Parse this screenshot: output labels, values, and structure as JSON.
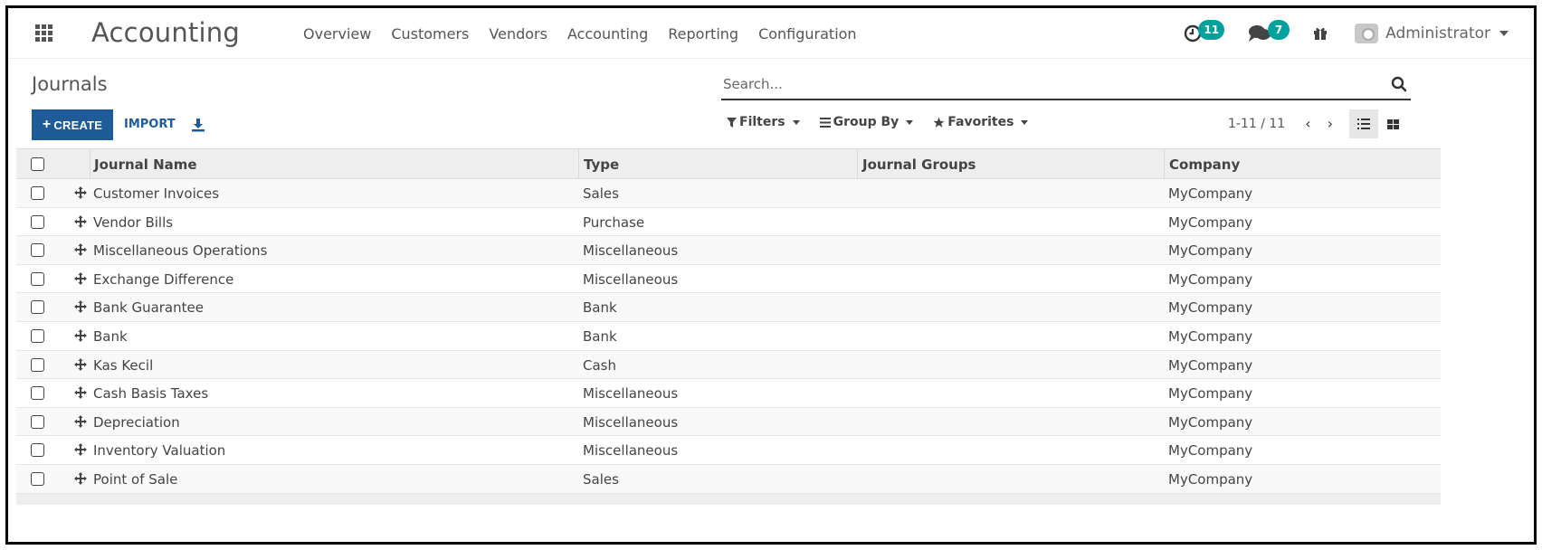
{
  "app": {
    "title": "Accounting"
  },
  "menu": [
    "Overview",
    "Customers",
    "Vendors",
    "Accounting",
    "Reporting",
    "Configuration"
  ],
  "systray": {
    "activity_count": "11",
    "messages_count": "7",
    "user": "Administrator"
  },
  "breadcrumb": "Journals",
  "search": {
    "placeholder": "Search..."
  },
  "actions": {
    "create": "CREATE",
    "import": "IMPORT"
  },
  "filters": {
    "filters": "Filters",
    "group_by": "Group By",
    "favorites": "Favorites"
  },
  "pager": {
    "range": "1-11 / 11"
  },
  "columns": [
    "Journal Name",
    "Type",
    "Journal Groups",
    "Company"
  ],
  "rows": [
    {
      "name": "Customer Invoices",
      "type": "Sales",
      "groups": "",
      "company": "MyCompany"
    },
    {
      "name": "Vendor Bills",
      "type": "Purchase",
      "groups": "",
      "company": "MyCompany"
    },
    {
      "name": "Miscellaneous Operations",
      "type": "Miscellaneous",
      "groups": "",
      "company": "MyCompany"
    },
    {
      "name": "Exchange Difference",
      "type": "Miscellaneous",
      "groups": "",
      "company": "MyCompany"
    },
    {
      "name": "Bank Guarantee",
      "type": "Bank",
      "groups": "",
      "company": "MyCompany"
    },
    {
      "name": "Bank",
      "type": "Bank",
      "groups": "",
      "company": "MyCompany"
    },
    {
      "name": "Kas Kecil",
      "type": "Cash",
      "groups": "",
      "company": "MyCompany"
    },
    {
      "name": "Cash Basis Taxes",
      "type": "Miscellaneous",
      "groups": "",
      "company": "MyCompany"
    },
    {
      "name": "Depreciation",
      "type": "Miscellaneous",
      "groups": "",
      "company": "MyCompany"
    },
    {
      "name": "Inventory Valuation",
      "type": "Miscellaneous",
      "groups": "",
      "company": "MyCompany"
    },
    {
      "name": "Point of Sale",
      "type": "Sales",
      "groups": "",
      "company": "MyCompany"
    }
  ],
  "colors": {
    "primary": "#1f5c97",
    "badge": "#00a09d"
  }
}
